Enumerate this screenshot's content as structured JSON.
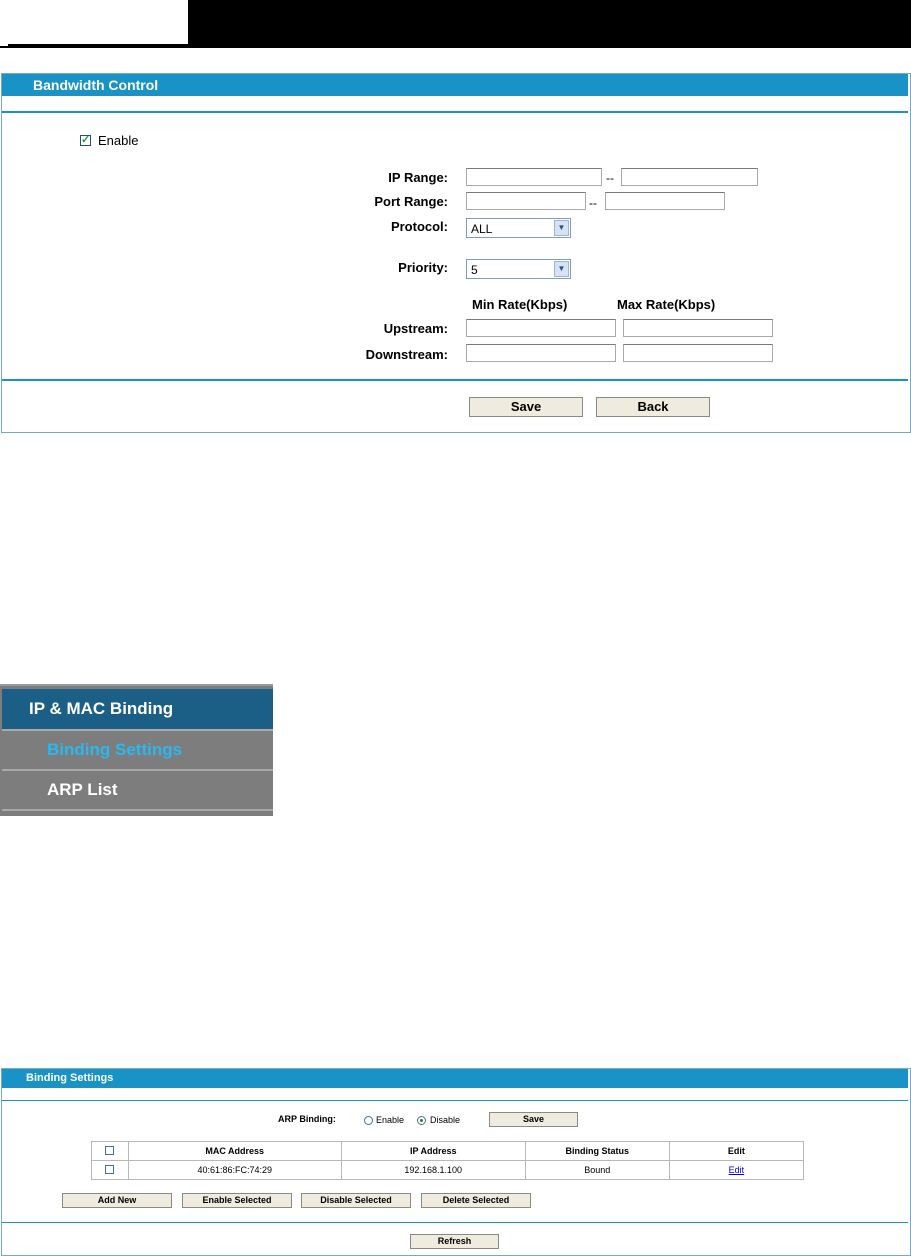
{
  "bandwidth": {
    "title": "Bandwidth Control",
    "enable_label": "Enable",
    "enable_checked": true,
    "ip_range_label": "IP Range:",
    "port_range_label": "Port Range:",
    "protocol_label": "Protocol:",
    "protocol_value": "ALL",
    "priority_label": "Priority:",
    "priority_value": "5",
    "range_sep": "--",
    "min_rate_header": "Min Rate(Kbps)",
    "max_rate_header": "Max Rate(Kbps)",
    "upstream_label": "Upstream:",
    "downstream_label": "Downstream:",
    "save_label": "Save",
    "back_label": "Back"
  },
  "menu": {
    "items": [
      {
        "label": "IP & MAC Binding",
        "active": false
      },
      {
        "label": "Binding Settings",
        "active": true
      },
      {
        "label": "ARP List",
        "active": false
      }
    ]
  },
  "binding": {
    "title": "Binding Settings",
    "arp_binding_label": "ARP Binding:",
    "enable_label": "Enable",
    "disable_label": "Disable",
    "selected": "Disable",
    "save_label": "Save",
    "columns": [
      "MAC Address",
      "IP Address",
      "Binding Status",
      "Edit"
    ],
    "rows": [
      {
        "mac": "40:61:86:FC:74:29",
        "ip": "192.168.1.100",
        "status": "Bound",
        "edit": "Edit"
      }
    ],
    "add_new_label": "Add New",
    "enable_selected_label": "Enable Selected",
    "disable_selected_label": "Disable Selected",
    "delete_selected_label": "Delete Selected",
    "refresh_label": "Refresh"
  },
  "colors": {
    "accent": "#1992c6",
    "menu_bg": "#7d7d7d",
    "menu_active_text": "#2ab8f0",
    "menu_header_bg": "#1c5f86"
  }
}
